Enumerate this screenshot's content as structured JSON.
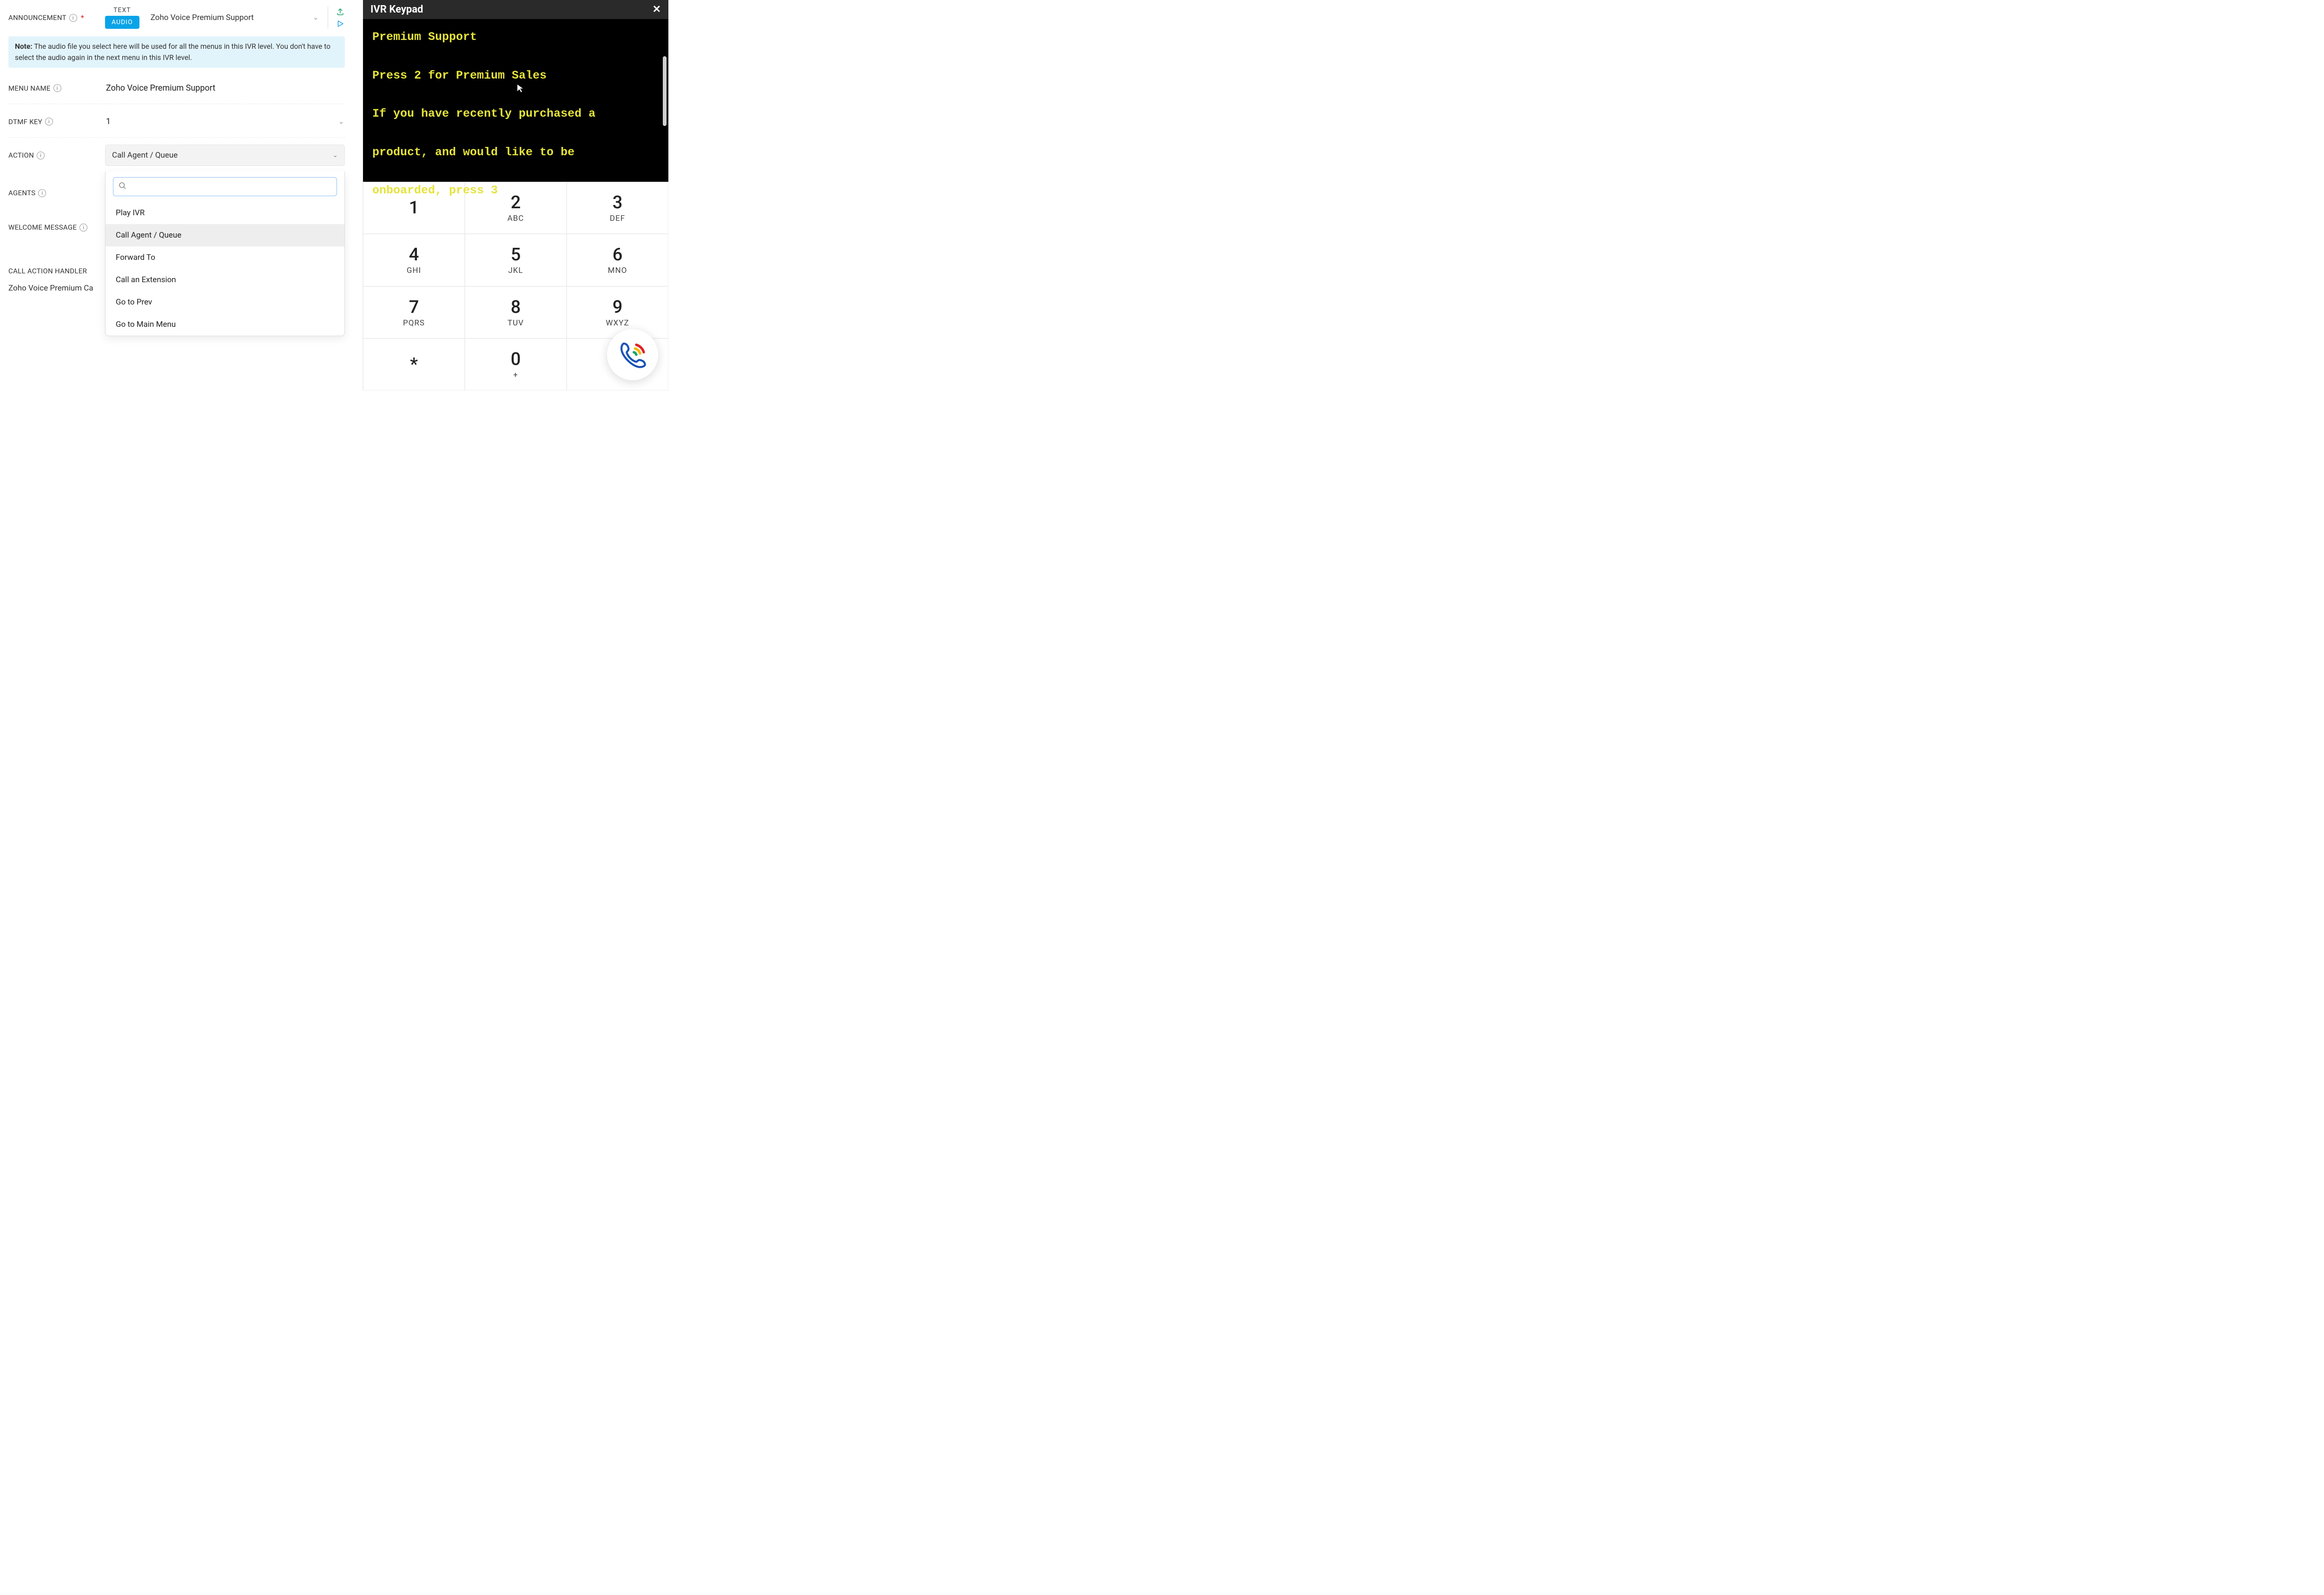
{
  "left": {
    "announcement": {
      "label": "ANNOUNCEMENT",
      "tab_text": "TEXT",
      "tab_audio": "AUDIO",
      "selected_audio": "Zoho Voice Premium Support"
    },
    "note": {
      "bold": "Note:",
      "text": " The audio file you select here will be used for all the menus in this IVR level. You don't have to select the audio again in the next menu in this IVR level."
    },
    "menu_name": {
      "label": "MENU NAME",
      "value": "Zoho Voice Premium Support"
    },
    "dtmf_key": {
      "label": "DTMF KEY",
      "value": "1"
    },
    "action": {
      "label": "ACTION",
      "value": "Call Agent / Queue"
    },
    "agents": {
      "label": "AGENTS"
    },
    "welcome": {
      "label": "WELCOME MESSAGE"
    },
    "handler": {
      "label_partial": "CALL ACTION HANDLER",
      "value_partial": "Zoho Voice Premium Ca"
    },
    "dropdown": {
      "search_placeholder": "",
      "options": [
        "Play IVR",
        "Call Agent / Queue",
        "Forward To",
        "Call an Extension",
        "Go to Prev",
        "Go to Main Menu"
      ],
      "highlighted_index": 1
    }
  },
  "keypad": {
    "title": "IVR Keypad",
    "display_lines": [
      "Premium Support",
      "",
      "Press 2 for Premium Sales",
      "",
      "If you have recently purchased a",
      "",
      "product, and would like to be",
      "",
      "onboarded, press 3"
    ],
    "keys": [
      {
        "digit": "1",
        "letters": ""
      },
      {
        "digit": "2",
        "letters": "ABC"
      },
      {
        "digit": "3",
        "letters": "DEF"
      },
      {
        "digit": "4",
        "letters": "GHI"
      },
      {
        "digit": "5",
        "letters": "JKL"
      },
      {
        "digit": "6",
        "letters": "MNO"
      },
      {
        "digit": "7",
        "letters": "PQRS"
      },
      {
        "digit": "8",
        "letters": "TUV"
      },
      {
        "digit": "9",
        "letters": "WXYZ"
      },
      {
        "digit": "*",
        "letters": ""
      },
      {
        "digit": "0",
        "letters": "+"
      },
      {
        "digit": "",
        "letters": ""
      }
    ]
  }
}
